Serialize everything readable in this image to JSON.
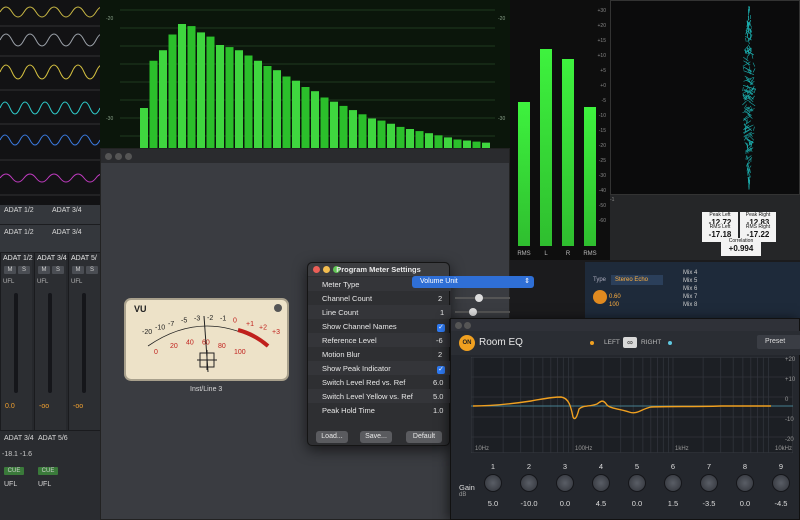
{
  "console": {
    "channels": [
      {
        "name": "ADAT 3/4",
        "ufl": "UFL",
        "value": "-oo"
      },
      {
        "name": "ADAT 5/",
        "ufl": "UFL",
        "value": "-oo"
      },
      {
        "name": "ADAT 5/6",
        "ufl": "UFL",
        "value": "-oo"
      }
    ],
    "top_rows": [
      "ADAT 1/2",
      "ADAT 3/4"
    ],
    "left_labels": [
      "ADAT 1/2",
      "UFL",
      "0.0",
      "ADAT 3/4",
      "UFL",
      "0.0"
    ],
    "btn_m": "M",
    "btn_s": "S",
    "btn_cue": "CUE",
    "val_bottom": "-18.1 -1.6"
  },
  "spectrum": {
    "scale_labels": [
      "-20",
      "-30",
      "-20",
      "-30"
    ]
  },
  "bigmeters": {
    "labels": [
      "RMS",
      "L",
      "R",
      "RMS"
    ],
    "levels": [
      0.6,
      0.82,
      0.78,
      0.58
    ],
    "scale": [
      "+30",
      "+20",
      "+15",
      "+10",
      "+5",
      "+0",
      "-5",
      "-10",
      "-15",
      "-20",
      "-25",
      "-30",
      "-40",
      "-50",
      "-60"
    ]
  },
  "scope": {
    "peak_left_label": "Peak Left",
    "peak_left": "-12.72",
    "peak_right_label": "Peak Right",
    "peak_right": "-12.83",
    "rms_left_label": "RMS Left",
    "rms_left": "-17.18",
    "rms_right_label": "RMS Right",
    "rms_right": "-17.22",
    "corr_label": "Correlation",
    "corr": "+0.994",
    "marker": "-1"
  },
  "echo": {
    "type_label": "Type",
    "type_value": "Stereo Echo",
    "knob_val": "0.60",
    "knob_val2": "100",
    "mixes": [
      "Mix 4",
      "Mix 5",
      "Mix 6",
      "Mix 7",
      "Mix 8"
    ]
  },
  "vu": {
    "label": "VU",
    "black_scale": [
      "-20",
      "-10",
      "-7",
      "-5",
      "-3",
      "-2",
      "-1",
      "0",
      "+1",
      "+2",
      "+3"
    ],
    "red_scale": [
      "0",
      "20",
      "40",
      "60",
      "80",
      "100"
    ],
    "caption": "Inst/Line 3"
  },
  "settings": {
    "title": "Program Meter Settings",
    "rows": [
      {
        "label": "Meter Type",
        "value": "Volume Unit"
      },
      {
        "label": "Channel Count",
        "value": "2"
      },
      {
        "label": "Line Count",
        "value": "1"
      },
      {
        "label": "Show Channel Names",
        "value": ""
      },
      {
        "label": "Reference Level",
        "value": "-6"
      },
      {
        "label": "Motion Blur",
        "value": "2"
      },
      {
        "label": "Show Peak Indicator",
        "value": ""
      },
      {
        "label": "Switch Level Red vs. Ref",
        "value": "6.0"
      },
      {
        "label": "Switch Level Yellow vs. Ref",
        "value": "5.0"
      },
      {
        "label": "Peak Hold Time",
        "value": "1.0"
      }
    ],
    "check_mark": "✓",
    "load": "Load...",
    "save": "Save...",
    "default": "Default"
  },
  "roomeq": {
    "on": "ON",
    "title": "Room EQ",
    "left": "LEFT",
    "link": "∞",
    "right": "RIGHT",
    "preset": "Preset",
    "freq_labels": [
      "10Hz",
      "100Hz",
      "1kHz",
      "10kHz"
    ],
    "db_labels": [
      "+20",
      "+10",
      "0",
      "-10",
      "-20"
    ],
    "gain_label": "Gain",
    "gain_unit": "dB",
    "bands": [
      "1",
      "2",
      "3",
      "4",
      "5",
      "6",
      "7",
      "8",
      "9"
    ],
    "gains": [
      "5.0",
      "-10.0",
      "0.0",
      "4.5",
      "0.0",
      "1.5",
      "-3.5",
      "0.0",
      "-4.5"
    ],
    "accent": "#f0a020"
  }
}
